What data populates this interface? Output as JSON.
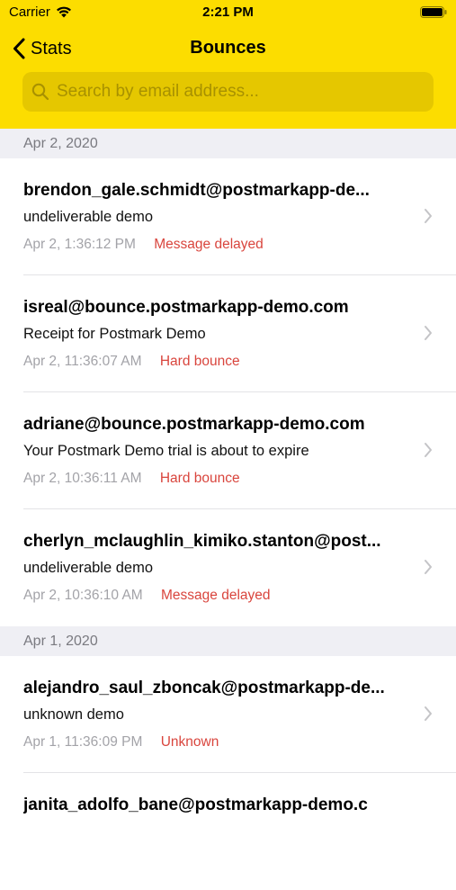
{
  "status_bar": {
    "carrier": "Carrier",
    "time": "2:21 PM"
  },
  "nav": {
    "back_label": "Stats",
    "title": "Bounces"
  },
  "search": {
    "placeholder": "Search by email address...",
    "value": ""
  },
  "colors": {
    "header": "#fcdd00",
    "search_bg": "#e5c700",
    "status_red": "#d9453d",
    "section_bg": "#efeff4"
  },
  "sections": [
    {
      "date": "Apr 2, 2020",
      "items": [
        {
          "email": "brendon_gale.schmidt@postmarkapp-de...",
          "subject": "undeliverable demo",
          "time": "Apr 2, 1:36:12 PM",
          "status": "Message delayed"
        },
        {
          "email": "isreal@bounce.postmarkapp-demo.com",
          "subject": "Receipt for Postmark Demo",
          "time": "Apr 2, 11:36:07 AM",
          "status": "Hard bounce"
        },
        {
          "email": "adriane@bounce.postmarkapp-demo.com",
          "subject": "Your Postmark Demo trial is about to expire",
          "time": "Apr 2, 10:36:11 AM",
          "status": "Hard bounce"
        },
        {
          "email": "cherlyn_mclaughlin_kimiko.stanton@post...",
          "subject": "undeliverable demo",
          "time": "Apr 2, 10:36:10 AM",
          "status": "Message delayed"
        }
      ]
    },
    {
      "date": "Apr 1, 2020",
      "items": [
        {
          "email": "alejandro_saul_zboncak@postmarkapp-de...",
          "subject": "unknown demo",
          "time": "Apr 1, 11:36:09 PM",
          "status": "Unknown"
        },
        {
          "email": "janita_adolfo_bane@postmarkapp-demo.c",
          "subject": "",
          "time": "",
          "status": ""
        }
      ]
    }
  ]
}
